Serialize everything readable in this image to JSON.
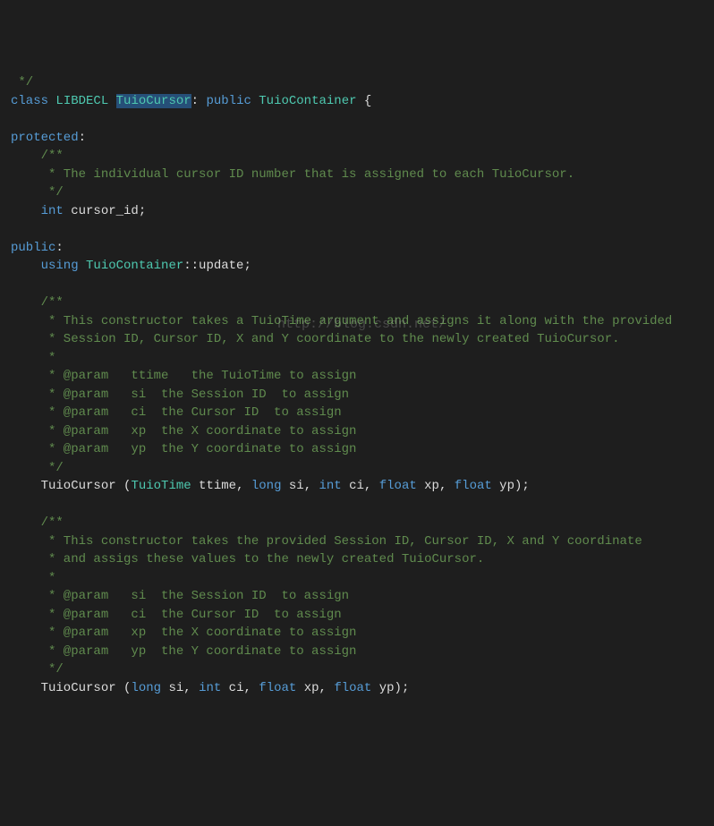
{
  "l0_a": " */",
  "l1_class": "class",
  "l1_libdecl": "LIBDECL",
  "l1_tuiocursor": "TuioCursor",
  "l1_colon": ":",
  "l1_public": " public",
  "l1_container": " TuioContainer",
  "l1_brace": " {",
  "l3_protected": "protected",
  "l3_colon": ":",
  "l4": "    /**",
  "l5": "     * The individual cursor ID number that is assigned to each TuioCursor.",
  "l6": "     */",
  "l7_int": "    int",
  "l7_var": " cursor_id",
  "l7_semi": ";",
  "l9_public": "public",
  "l9_colon": ":",
  "l10_using": "    using",
  "l10_container": " TuioContainer",
  "l10_update": "::update",
  "l10_semi": ";",
  "l12": "    /**",
  "l13": "     * This constructor takes a TuioTime argument and assigns it along with the provided",
  "l14": "     * Session ID, Cursor ID, X and Y coordinate to the newly created TuioCursor.",
  "l15": "     *",
  "l16": "     * @param   ttime   the TuioTime to assign",
  "l17": "     * @param   si  the Session ID  to assign",
  "l18": "     * @param   ci  the Cursor ID  to assign",
  "l19": "     * @param   xp  the X coordinate to assign",
  "l20": "     * @param   yp  the Y coordinate to assign",
  "l21": "     */",
  "l22_name": "    TuioCursor ",
  "l22_p1": "(",
  "l22_t1": "TuioTime",
  "l22_v1": " ttime, ",
  "l22_t2": "long",
  "l22_v2": " si, ",
  "l22_t3": "int",
  "l22_v3": " ci, ",
  "l22_t4": "float",
  "l22_v4": " xp, ",
  "l22_t5": "float",
  "l22_v5": " yp)",
  "l22_semi": ";",
  "l24": "    /**",
  "l25": "     * This constructor takes the provided Session ID, Cursor ID, X and Y coordinate",
  "l26": "     * and assigs these values to the newly created TuioCursor.",
  "l27": "     *",
  "l28": "     * @param   si  the Session ID  to assign",
  "l29": "     * @param   ci  the Cursor ID  to assign",
  "l30": "     * @param   xp  the X coordinate to assign",
  "l31": "     * @param   yp  the Y coordinate to assign",
  "l32": "     */",
  "l33_name": "    TuioCursor ",
  "l33_p1": "(",
  "l33_t1": "long",
  "l33_v1": " si, ",
  "l33_t2": "int",
  "l33_v2": " ci, ",
  "l33_t3": "float",
  "l33_v3": " xp, ",
  "l33_t4": "float",
  "l33_v4": " yp)",
  "l33_semi": ";",
  "watermark": "http://blog.csdn.net/"
}
